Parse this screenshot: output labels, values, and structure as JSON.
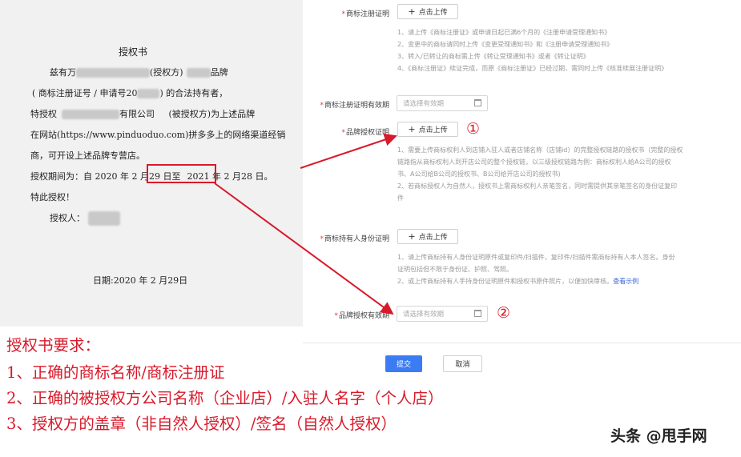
{
  "letter": {
    "title": "授权书",
    "line1_prefix": "兹有万",
    "line1_mid": "(授权方)",
    "line1_end": "品牌",
    "line2_prefix": "( 商标注册证号 / 申请号20",
    "line2_end": ")  的合法持有者，",
    "line3_prefix": "特授权",
    "line3_mid": "有限公司",
    "line3_end": "(被授权方)为上述品牌",
    "line4": "在网站(https://www.pinduoduo.com)拼多多上的网络渠道经销",
    "line5": "商，可开设上述品牌专营店。",
    "line6_prefix": "授权期间为：自 2020 年 2 月29 日至",
    "line6_highlight": "2021 年 2 月28 日。",
    "line7": "特此授权！",
    "line8": "授权人：",
    "date": "日期:2020 年 2 月29日"
  },
  "form": {
    "trademark_cert_label": "商标注册证明",
    "upload_label": "点击上传",
    "trademark_notes": [
      "1、请上传《商标注册证》或申请日起已满6个月的《注册申请受理通知书》",
      "2、变更中的商标请同时上传《变更受理通知书》和《注册申请受理通知书》",
      "3、转入/已转让的商标需上传《转让受理通知书》或者《转让证明》",
      "4、《商标注册证》续证完成，而原《商标注册证》已经过期，需同时上传《核准续展注册证明》"
    ],
    "trademark_validity_label": "商标注册证明有效期",
    "date_placeholder": "请选择有效期",
    "brand_auth_label": "品牌授权证明",
    "brand_auth_notes": [
      "1、需要上传商标权利人到店铺入驻人或者店铺名称（店铺id）的完整授权链路的授权书（完整的授权",
      "链路指从商标权利人到开店公司的整个授权链，以三级授权链路为例：商标权利人给A公司的授权",
      "书、A公司给B公司的授权书、B公司给开店公司的授权书)",
      "2、若商标授权人为自然人，授权书上需商标权利人亲笔签名，同时需提供其亲笔签名的身份证复印",
      "件"
    ],
    "holder_id_label": "商标持有人身份证明",
    "holder_notes": [
      "1、请上传商标持有人身份证明原件或复印件/扫描件，复印件/扫描件需商标持有人本人签名。身份",
      "证明包括但不限于身份证、护照、驾照。",
      "2、或上传商标持有人手持身份证明原件和授权书原件照片，以便加快审核。"
    ],
    "example_link": "查看示例",
    "brand_validity_label": "品牌授权有效期",
    "submit": "提交",
    "cancel": "取消"
  },
  "markers": {
    "one": "①",
    "two": "②"
  },
  "requirements": {
    "title": "授权书要求：",
    "items": [
      "1、正确的商标名称/商标注册证",
      "2、正确的被授权方公司名称（企业店）/入驻人名字（个人店）",
      "3、授权方的盖章（非自然人授权）/签名（自然人授权）"
    ]
  },
  "watermark": "头条 @甩手网",
  "colors": {
    "accent_red": "#d9192a",
    "primary_blue": "#3b7cf5",
    "link_blue": "#3a66d6"
  }
}
